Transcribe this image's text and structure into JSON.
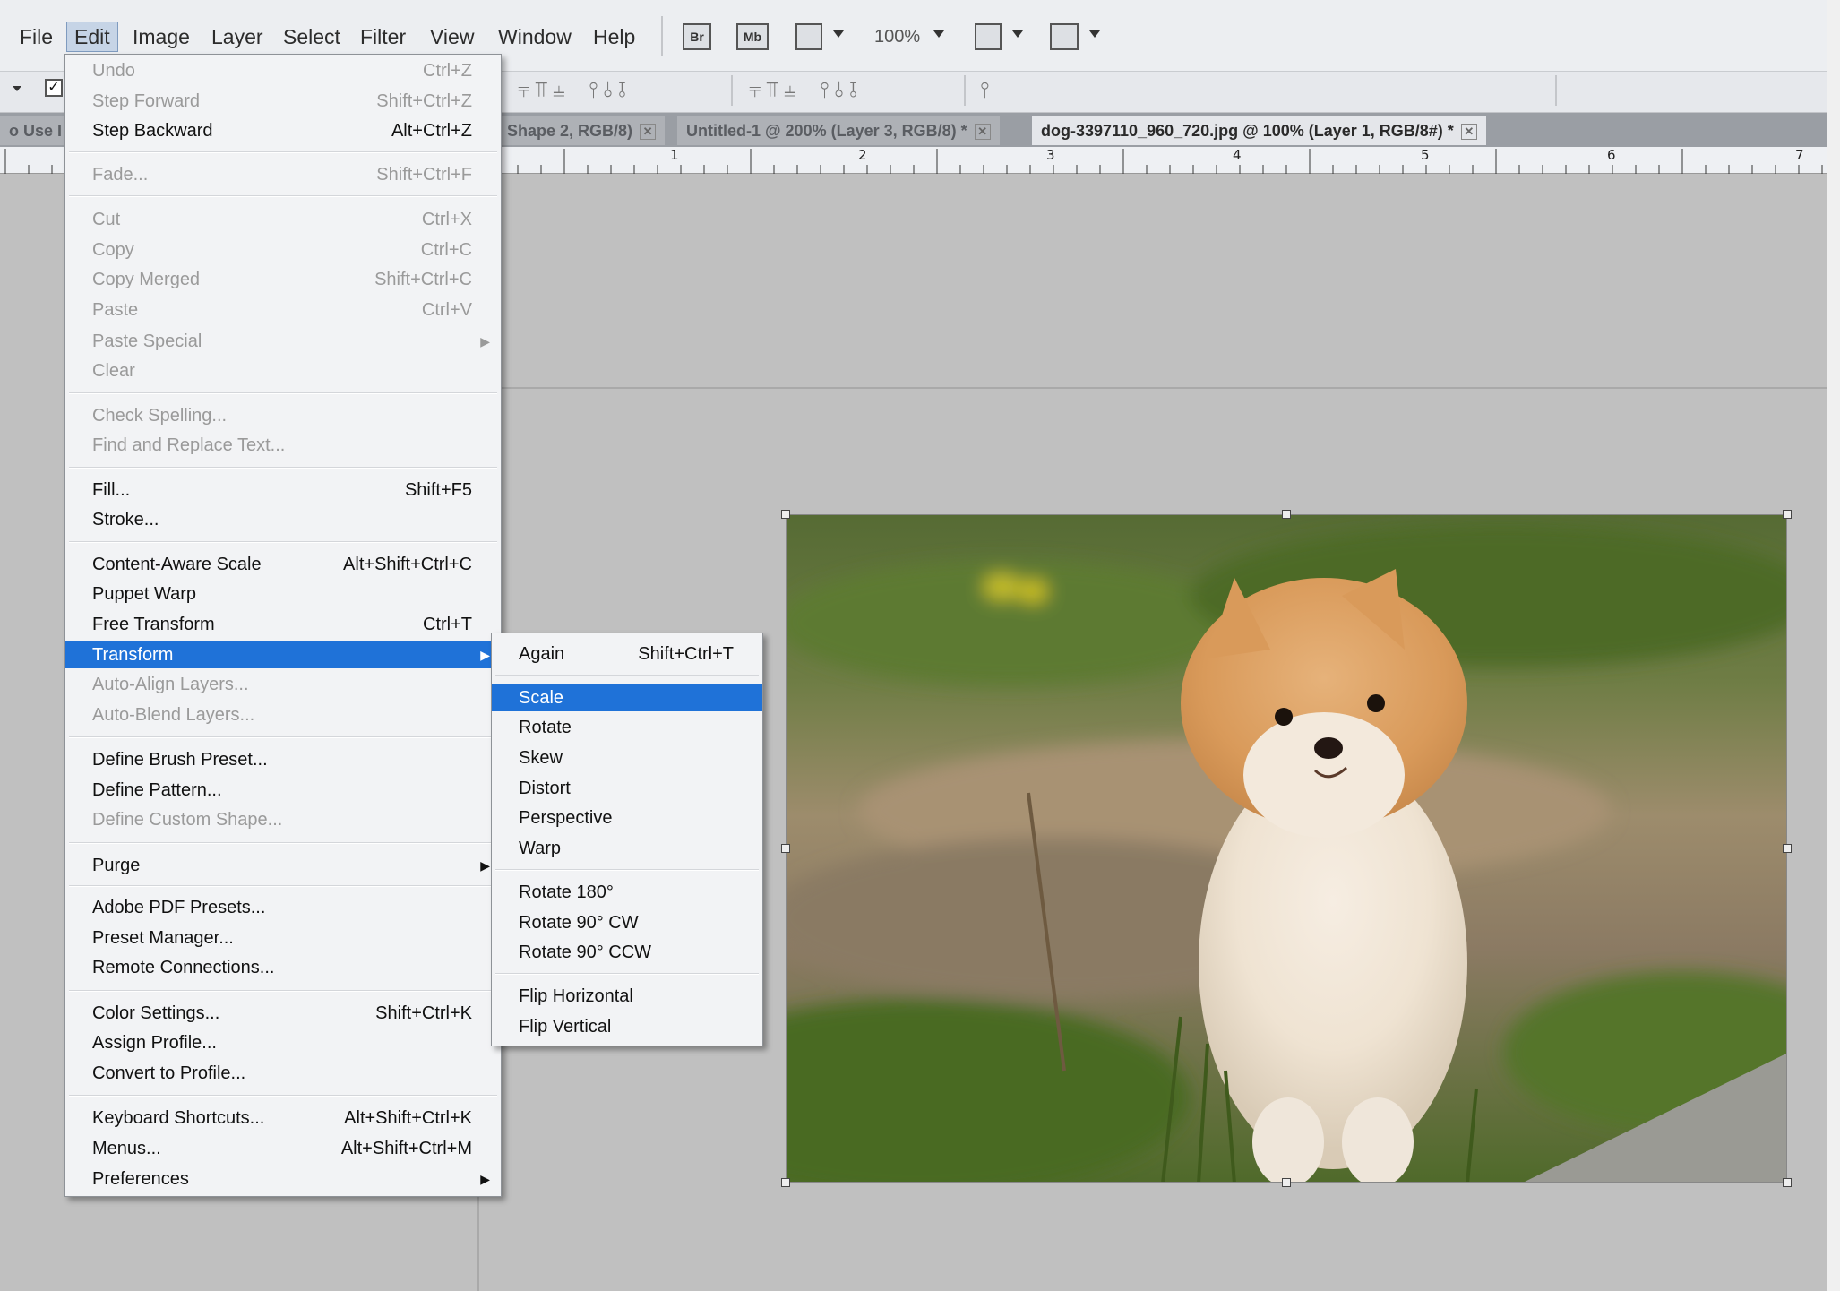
{
  "menubar": {
    "items": [
      "File",
      "Edit",
      "Image",
      "Layer",
      "Select",
      "Filter",
      "View",
      "Window",
      "Help"
    ],
    "active": "Edit",
    "toolbar_icons": [
      "bridge-icon",
      "minibridge-icon",
      "screen-mode-icon",
      "arrange-icon",
      "workspace-icon"
    ],
    "bridge_label": "Br",
    "minibridge_label": "Mb",
    "zoom": "100%"
  },
  "options_bar": {
    "checkbox_checked": true,
    "align_icons_1": "⫧⫪⫨ ⫯⫰⫱",
    "align_icons_2": "⫧⫪⫨ ⫯⫰⫱",
    "align_icons_3": "⫯"
  },
  "tabs": [
    {
      "label": "o Use I",
      "active": false
    },
    {
      "label": "Shape 2, RGB/8)",
      "active": false
    },
    {
      "label": "Untitled-1 @ 200% (Layer 3, RGB/8) *",
      "active": false
    },
    {
      "label": "dog-3397110_960_720.jpg @ 100% (Layer 1, RGB/8#) *",
      "active": true
    }
  ],
  "ruler": {
    "numbers": [
      "1",
      "2",
      "3",
      "4",
      "5",
      "6",
      "7"
    ]
  },
  "edit_menu": {
    "items": [
      {
        "label": "Undo",
        "shortcut": "Ctrl+Z",
        "disabled": true
      },
      {
        "label": "Step Forward",
        "shortcut": "Shift+Ctrl+Z",
        "disabled": true
      },
      {
        "label": "Step Backward",
        "shortcut": "Alt+Ctrl+Z",
        "disabled": false
      },
      {
        "label": "Fade...",
        "shortcut": "Shift+Ctrl+F",
        "disabled": true
      },
      {
        "label": "Cut",
        "shortcut": "Ctrl+X",
        "disabled": true
      },
      {
        "label": "Copy",
        "shortcut": "Ctrl+C",
        "disabled": true
      },
      {
        "label": "Copy Merged",
        "shortcut": "Shift+Ctrl+C",
        "disabled": true
      },
      {
        "label": "Paste",
        "shortcut": "Ctrl+V",
        "disabled": true
      },
      {
        "label": "Paste Special",
        "shortcut": "",
        "disabled": true,
        "submenu": true
      },
      {
        "label": "Clear",
        "shortcut": "",
        "disabled": true
      },
      {
        "label": "Check Spelling...",
        "shortcut": "",
        "disabled": true
      },
      {
        "label": "Find and Replace Text...",
        "shortcut": "",
        "disabled": true
      },
      {
        "label": "Fill...",
        "shortcut": "Shift+F5",
        "disabled": false
      },
      {
        "label": "Stroke...",
        "shortcut": "",
        "disabled": false
      },
      {
        "label": "Content-Aware Scale",
        "shortcut": "Alt+Shift+Ctrl+C",
        "disabled": false
      },
      {
        "label": "Puppet Warp",
        "shortcut": "",
        "disabled": false
      },
      {
        "label": "Free Transform",
        "shortcut": "Ctrl+T",
        "disabled": false
      },
      {
        "label": "Transform",
        "shortcut": "",
        "disabled": false,
        "submenu": true,
        "highlighted": true
      },
      {
        "label": "Auto-Align Layers...",
        "shortcut": "",
        "disabled": true
      },
      {
        "label": "Auto-Blend Layers...",
        "shortcut": "",
        "disabled": true
      },
      {
        "label": "Define Brush Preset...",
        "shortcut": "",
        "disabled": false
      },
      {
        "label": "Define Pattern...",
        "shortcut": "",
        "disabled": false
      },
      {
        "label": "Define Custom Shape...",
        "shortcut": "",
        "disabled": true
      },
      {
        "label": "Purge",
        "shortcut": "",
        "disabled": false,
        "submenu": true
      },
      {
        "label": "Adobe PDF Presets...",
        "shortcut": "",
        "disabled": false
      },
      {
        "label": "Preset Manager...",
        "shortcut": "",
        "disabled": false
      },
      {
        "label": "Remote Connections...",
        "shortcut": "",
        "disabled": false
      },
      {
        "label": "Color Settings...",
        "shortcut": "Shift+Ctrl+K",
        "disabled": false
      },
      {
        "label": "Assign Profile...",
        "shortcut": "",
        "disabled": false
      },
      {
        "label": "Convert to Profile...",
        "shortcut": "",
        "disabled": false
      },
      {
        "label": "Keyboard Shortcuts...",
        "shortcut": "Alt+Shift+Ctrl+K",
        "disabled": false
      },
      {
        "label": "Menus...",
        "shortcut": "Alt+Shift+Ctrl+M",
        "disabled": false
      },
      {
        "label": "Preferences",
        "shortcut": "",
        "disabled": false,
        "submenu": true
      }
    ]
  },
  "transform_submenu": {
    "items": [
      {
        "label": "Again",
        "shortcut": "Shift+Ctrl+T"
      },
      {
        "label": "Scale",
        "shortcut": "",
        "highlighted": true
      },
      {
        "label": "Rotate",
        "shortcut": ""
      },
      {
        "label": "Skew",
        "shortcut": ""
      },
      {
        "label": "Distort",
        "shortcut": ""
      },
      {
        "label": "Perspective",
        "shortcut": ""
      },
      {
        "label": "Warp",
        "shortcut": ""
      },
      {
        "label": "Rotate 180°",
        "shortcut": ""
      },
      {
        "label": "Rotate 90° CW",
        "shortcut": ""
      },
      {
        "label": "Rotate 90° CCW",
        "shortcut": ""
      },
      {
        "label": "Flip Horizontal",
        "shortcut": ""
      },
      {
        "label": "Flip Vertical",
        "shortcut": ""
      }
    ]
  },
  "colors": {
    "highlight": "#1f72d8",
    "menu_bg": "#f2f3f5",
    "canvas_bg": "#c0c0c0"
  }
}
